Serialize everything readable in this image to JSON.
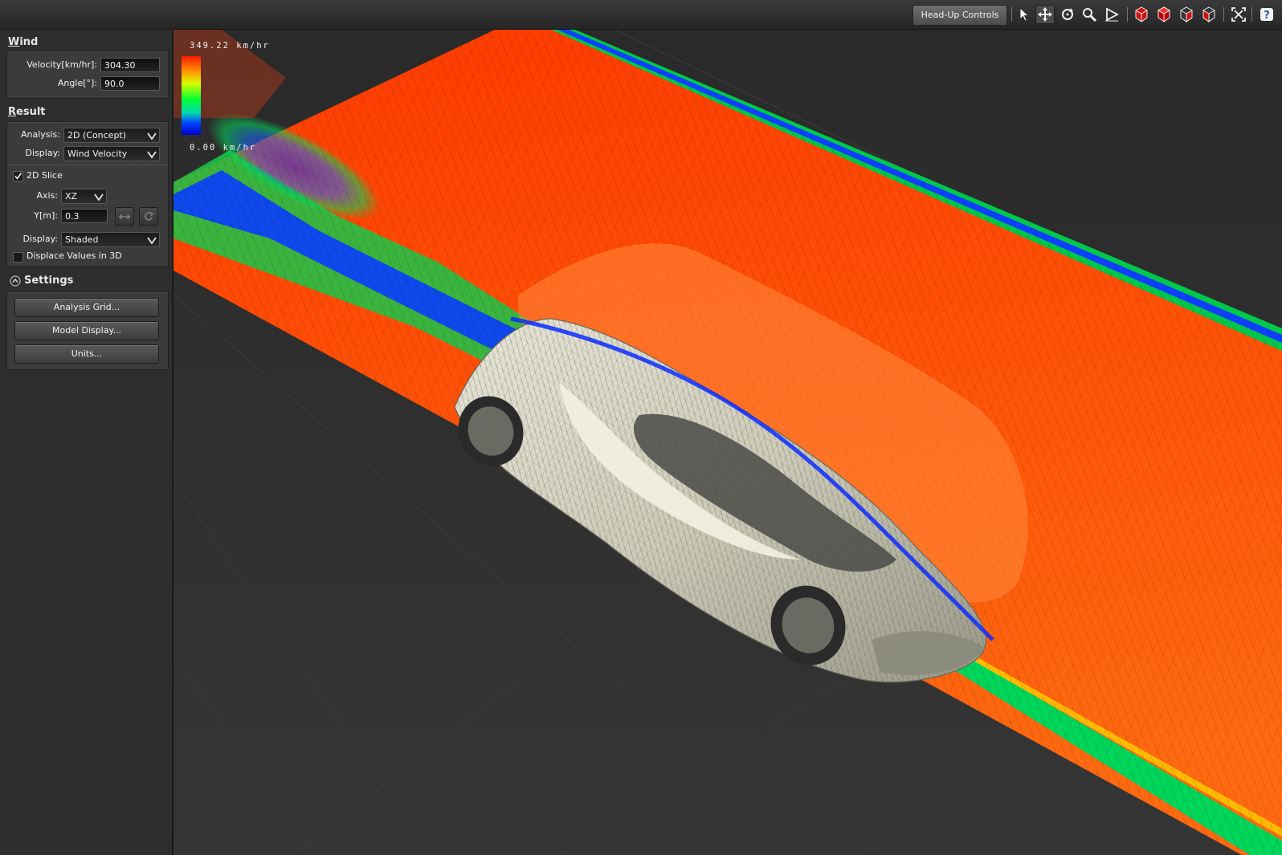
{
  "toolbar": {
    "hud_label": "Head-Up Controls",
    "icons": [
      "select-arrow-icon",
      "pan-icon",
      "rotate-icon",
      "zoom-icon",
      "play-icon",
      "view-cube-front-icon",
      "view-cube-top-icon",
      "view-cube-side-icon",
      "view-cube-iso-icon",
      "fit-view-icon",
      "help-icon"
    ]
  },
  "wind": {
    "title_first": "W",
    "title_rest": "ind",
    "velocity_label": "Velocity[km/hr]:",
    "velocity_value": "304.30",
    "angle_label": "Angle[°]:",
    "angle_value": "90.0"
  },
  "result": {
    "title_first": "R",
    "title_rest": "esult",
    "analysis_label": "Analysis:",
    "analysis_value": "2D (Concept)",
    "display_label": "Display:",
    "display_value": "Wind Velocity",
    "slice_label": "2D Slice",
    "slice_checked": true,
    "axis_label": "Axis:",
    "axis_value": "XZ",
    "y_label": "Y[m]:",
    "y_value": "0.3",
    "display2_label": "Display:",
    "display2_value": "Shaded",
    "displace_label": "Displace Values in 3D",
    "displace_checked": false
  },
  "settings": {
    "title": "Settings",
    "buttons": [
      "Analysis Grid...",
      "Model Display...",
      "Units..."
    ]
  },
  "legend": {
    "max": "349.22 km/hr",
    "min": "0.00 km/hr",
    "colors": [
      "#ff1a00",
      "#ff9900",
      "#d4ff00",
      "#00ff33",
      "#00d9b0",
      "#0044ff",
      "#0000cc"
    ]
  }
}
